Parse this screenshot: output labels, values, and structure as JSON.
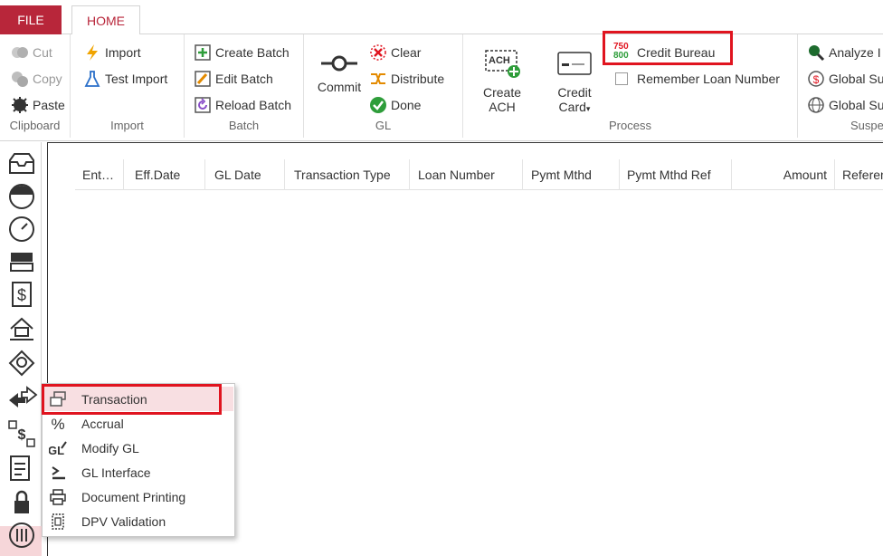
{
  "tabs": {
    "file": "FILE",
    "home": "HOME"
  },
  "clipboard": {
    "label": "Clipboard",
    "cut": "Cut",
    "copy": "Copy",
    "paste": "Paste"
  },
  "import": {
    "label": "Import",
    "import": "Import",
    "test_import": "Test Import"
  },
  "batch": {
    "label": "Batch",
    "create": "Create Batch",
    "edit": "Edit Batch",
    "reload": "Reload Batch"
  },
  "gl": {
    "label": "GL",
    "commit": "Commit",
    "clear": "Clear",
    "distribute": "Distribute",
    "done": "Done"
  },
  "process": {
    "label": "Process",
    "create_ach_line1": "Create",
    "create_ach_line2": "ACH",
    "ach_icon_text": "ACH",
    "credit_card_line1": "Credit",
    "credit_card_line2": "Card",
    "credit_bureau": "Credit Bureau",
    "score_top": "750",
    "score_bottom": "800",
    "remember_loan": "Remember Loan Number"
  },
  "suspense": {
    "label": "Suspe",
    "analyze": "Analyze I",
    "global1": "Global Su",
    "global2": "Global Su"
  },
  "grid": {
    "columns": [
      "Ent…",
      "Eff.Date",
      "GL Date",
      "Transaction Type",
      "Loan Number",
      "Pymt Mthd",
      "Pymt Mthd Ref",
      "Amount",
      "Referen"
    ]
  },
  "menu": {
    "items": [
      "Transaction",
      "Accrual",
      "Modify GL",
      "GL Interface",
      "Document Printing",
      "DPV Validation"
    ]
  },
  "colors": {
    "accent": "#b8263a",
    "highlight": "#e0141f",
    "selected_bg": "#f8dfe2"
  }
}
